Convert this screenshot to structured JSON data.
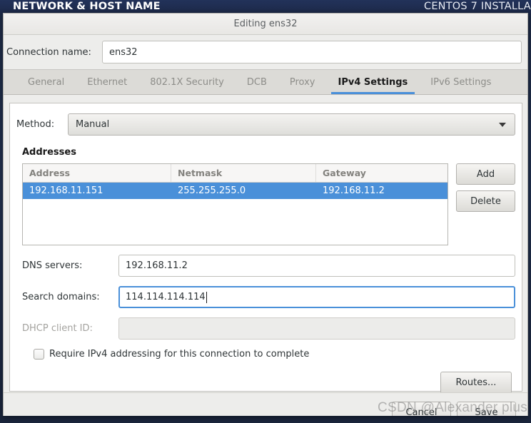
{
  "installer": {
    "header_left": "NETWORK & HOST NAME",
    "header_right": "CENTOS 7 INSTALLA"
  },
  "dialog": {
    "title": "Editing ens32",
    "connection_name_label": "Connection name:",
    "connection_name_value": "ens32",
    "tabs": [
      {
        "label": "General",
        "active": false
      },
      {
        "label": "Ethernet",
        "active": false
      },
      {
        "label": "802.1X Security",
        "active": false
      },
      {
        "label": "DCB",
        "active": false
      },
      {
        "label": "Proxy",
        "active": false
      },
      {
        "label": "IPv4 Settings",
        "active": true
      },
      {
        "label": "IPv6 Settings",
        "active": false
      }
    ],
    "method": {
      "label": "Method:",
      "value": "Manual"
    },
    "addresses": {
      "section_title": "Addresses",
      "columns": [
        "Address",
        "Netmask",
        "Gateway"
      ],
      "rows": [
        {
          "address": "192.168.11.151",
          "netmask": "255.255.255.0",
          "gateway": "192.168.11.2",
          "selected": true
        }
      ],
      "add_label": "Add",
      "delete_label": "Delete"
    },
    "dns_servers": {
      "label": "DNS servers:",
      "value": "192.168.11.2"
    },
    "search_domains": {
      "label": "Search domains:",
      "value": "114.114.114.114",
      "focused": true
    },
    "dhcp_client_id": {
      "label": "DHCP client ID:",
      "value": "",
      "disabled": true
    },
    "require_ipv4": {
      "label": "Require IPv4 addressing for this connection to complete",
      "checked": false
    },
    "routes_label": "Routes...",
    "cancel_label": "Cancel",
    "save_label": "Save"
  },
  "watermark": "CSDN @Alexander plus",
  "colors": {
    "accent": "#4a90d9",
    "header_bg": "#1d2a45",
    "dialog_bg": "#ededeb"
  }
}
